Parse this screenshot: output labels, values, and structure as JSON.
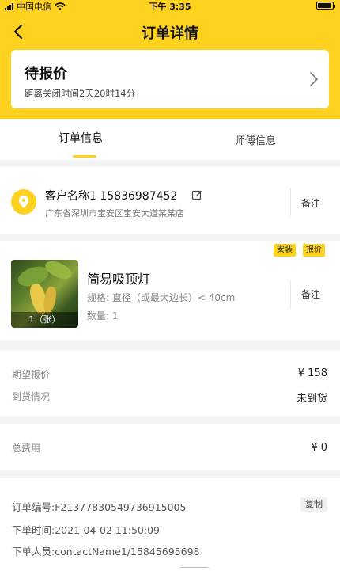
{
  "status_bar": {
    "carrier": "中国电信",
    "time": "下午 3:35"
  },
  "nav": {
    "title": "订单详情"
  },
  "order_status": {
    "title": "待报价",
    "subtitle": "距离关闭时间2天20时14分"
  },
  "tabs": [
    {
      "label": "订单信息",
      "active": true
    },
    {
      "label": "师傅信息",
      "active": false
    }
  ],
  "customer": {
    "name_phone": "客户名称1 15836987452",
    "address": "广东省深圳市宝安区宝安大道某某店",
    "note_label": "备注"
  },
  "product": {
    "tags": [
      "安装",
      "报价"
    ],
    "name": "简易吸顶灯",
    "spec": "规格: 直径（或最大边长）< 40cm",
    "quantity": "数量: 1",
    "image_caption": "1（张）",
    "note_label": "备注"
  },
  "pricing": {
    "expected_label": "期望报价",
    "expected_value": "¥ 158",
    "arrival_label": "到货情况",
    "arrival_value": "未到货"
  },
  "total": {
    "label": "总费用",
    "value": "¥ 0"
  },
  "order_info": {
    "order_no": "订单编号:F21377830549736915005",
    "copy_label": "复制",
    "order_time": "下单时间:2021-04-02 11:50:09",
    "order_person": "下单人员:contactName1/15845695698"
  },
  "colors": {
    "accent": "#ffd21f",
    "background": "#f3f3f3"
  }
}
